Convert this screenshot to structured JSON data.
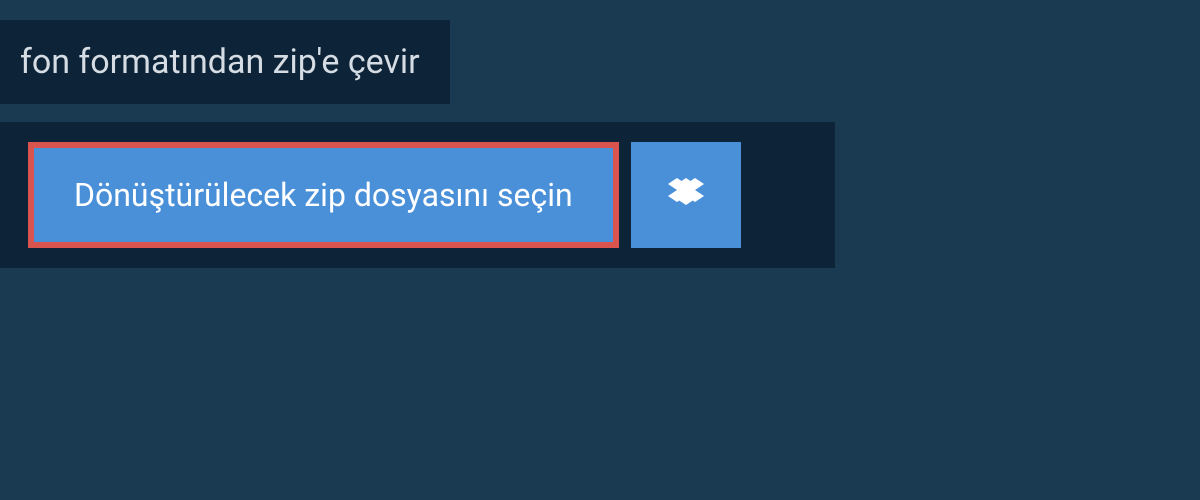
{
  "header": {
    "title": "fon formatından zip'e çevir"
  },
  "actions": {
    "select_file_label": "Dönüştürülecek zip dosyasını seçin"
  },
  "colors": {
    "background": "#1a3a52",
    "panel": "#0d2438",
    "button": "#4a90d9",
    "highlight_border": "#d9534f",
    "text_light": "#ffffff",
    "text_muted": "#d5dce3"
  }
}
